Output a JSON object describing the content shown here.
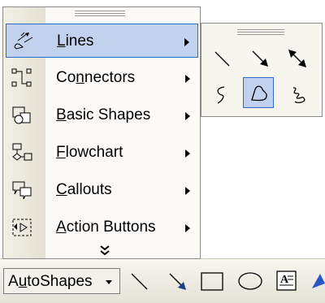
{
  "autoshapes_menu": {
    "items": [
      {
        "prefix": "",
        "accel": "L",
        "suffix": "ines",
        "icon": "lines-icon",
        "highlighted": true
      },
      {
        "prefix": "Co",
        "accel": "n",
        "suffix": "nectors",
        "icon": "connectors-icon",
        "highlighted": false
      },
      {
        "prefix": "",
        "accel": "B",
        "suffix": "asic Shapes",
        "icon": "basic-shapes-icon",
        "highlighted": false
      },
      {
        "prefix": "",
        "accel": "F",
        "suffix": "lowchart",
        "icon": "flowchart-icon",
        "highlighted": false
      },
      {
        "prefix": "",
        "accel": "C",
        "suffix": "allouts",
        "icon": "callouts-icon",
        "highlighted": false
      },
      {
        "prefix": "",
        "accel": "A",
        "suffix": "ction Buttons",
        "icon": "action-buttons-icon",
        "highlighted": false
      }
    ],
    "more_icon": "expand-chevron-icon"
  },
  "lines_submenu": {
    "buttons": [
      {
        "icon": "line-icon",
        "selected": false
      },
      {
        "icon": "arrow-icon",
        "selected": false
      },
      {
        "icon": "double-arrow-icon",
        "selected": false
      },
      {
        "icon": "curve-icon",
        "selected": false
      },
      {
        "icon": "freeform-icon",
        "selected": true
      },
      {
        "icon": "scribble-icon",
        "selected": false
      }
    ]
  },
  "toolbar": {
    "autoshapes_prefix": "A",
    "autoshapes_accel": "u",
    "autoshapes_suffix": "toShapes",
    "buttons": [
      {
        "icon": "line-tool-icon"
      },
      {
        "icon": "arrow-tool-icon"
      },
      {
        "icon": "rectangle-tool-icon"
      },
      {
        "icon": "oval-tool-icon"
      },
      {
        "icon": "text-box-tool-icon"
      },
      {
        "icon": "wordart-tool-icon"
      }
    ]
  },
  "colors": {
    "highlight_fill": "#c1d2ee",
    "highlight_border": "#316ac5",
    "menu_background": "#fbfaf6",
    "icon_strip": "#e4e1d2"
  }
}
